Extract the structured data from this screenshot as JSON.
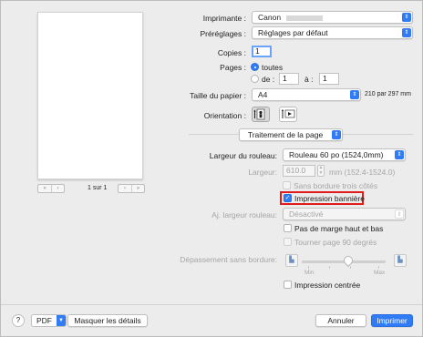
{
  "preview": {
    "page_counter": "1 sur 1",
    "nav_first": "«",
    "nav_prev": "‹",
    "nav_next": "›",
    "nav_last": "»"
  },
  "printer": {
    "label": "Imprimante :",
    "value": "Canon"
  },
  "presets": {
    "label": "Préréglages :",
    "value": "Réglages par défaut"
  },
  "copies": {
    "label": "Copies :",
    "value": "1"
  },
  "pages": {
    "label": "Pages :",
    "all_label": "toutes",
    "from_label": "de :",
    "from_value": "1",
    "to_label": "à :",
    "to_value": "1"
  },
  "paper_size": {
    "label": "Taille du papier :",
    "value": "A4",
    "dimensions": "210 par 297 mm"
  },
  "orientation": {
    "label": "Orientation :",
    "portrait_icon": "portrait-icon",
    "landscape_icon": "landscape-icon"
  },
  "section": {
    "value": "Traitement de la page"
  },
  "roll_width": {
    "label": "Largeur du rouleau:",
    "value": "Rouleau 60 po (1524,0mm)"
  },
  "width": {
    "label": "Largeur:",
    "value": "610.0",
    "unit_range": "mm (152.4-1524.0)"
  },
  "no_border_three_sides": {
    "label": "Sans bordure trois côtés",
    "checked": false
  },
  "banner_print": {
    "label": "Impression bannière",
    "checked": true
  },
  "adjust_roll_width": {
    "label": "Aj. largeur rouleau:",
    "value": "Désactivé"
  },
  "no_top_bottom_margin": {
    "label": "Pas de marge haut et bas",
    "checked": false
  },
  "rotate_page": {
    "label": "Tourner page 90 degrés",
    "checked": false
  },
  "borderless_overflow": {
    "label": "Dépassement sans bordure:",
    "min_label": "Min",
    "max_label": "Max",
    "level": 0.55
  },
  "centered_print": {
    "label": "Impression centrée",
    "checked": false
  },
  "footer": {
    "help": "?",
    "pdf": "PDF",
    "hide_details": "Masquer les détails",
    "cancel": "Annuler",
    "print": "Imprimer"
  },
  "colors": {
    "accent": "#2f7cf6",
    "highlight": "#e01b1b"
  }
}
